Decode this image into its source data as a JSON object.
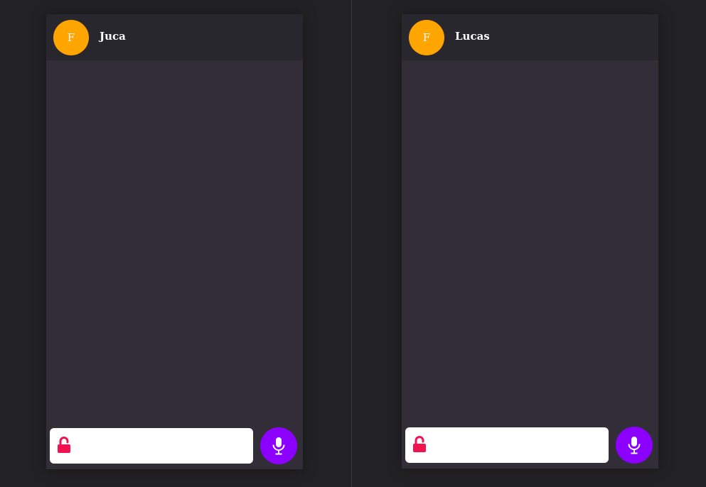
{
  "colors": {
    "avatar": "#ffa500",
    "lock": "#f0134f",
    "mic_button": "#8b00ff",
    "panel": "#312e38",
    "header": "#29272e",
    "background": "#222124"
  },
  "chats": [
    {
      "avatar_initial": "F",
      "contact_name": "Juca",
      "message_placeholder": "",
      "lock_icon": "unlocked-padlock-icon",
      "mic_icon": "microphone-icon"
    },
    {
      "avatar_initial": "F",
      "contact_name": "Lucas",
      "message_placeholder": "",
      "lock_icon": "unlocked-padlock-icon",
      "mic_icon": "microphone-icon"
    }
  ]
}
